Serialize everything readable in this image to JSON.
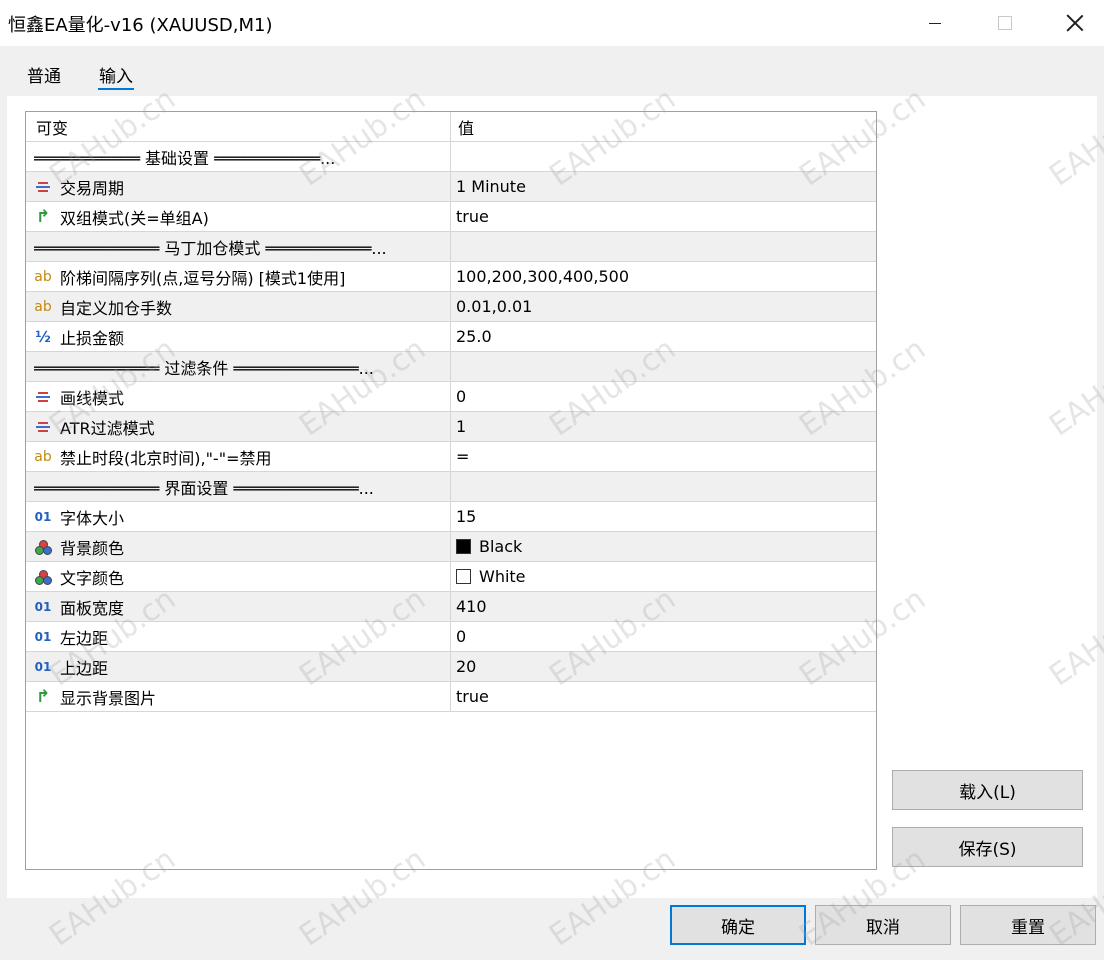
{
  "window": {
    "title": "恒鑫EA量化-v16 (XAUUSD,M1)"
  },
  "tabs": [
    {
      "label": "普通"
    },
    {
      "label": "输入"
    }
  ],
  "table": {
    "header": {
      "name": "可变",
      "value": "值"
    },
    "rows": [
      {
        "icon": "none",
        "name": "═══════════ 基础设置 ═══════════...",
        "value": ""
      },
      {
        "icon": "enum-icon",
        "name": "交易周期",
        "value": "1 Minute"
      },
      {
        "icon": "bool-icon",
        "name": "双组模式(关=单组A)",
        "value": "true"
      },
      {
        "icon": "none",
        "name": "═════════════ 马丁加仓模式 ═══════════...",
        "value": ""
      },
      {
        "icon": "string-icon",
        "name": "阶梯间隔序列(点,逗号分隔) [模式1使用]",
        "value": "100,200,300,400,500"
      },
      {
        "icon": "string-icon",
        "name": "自定义加仓手数",
        "value": "0.01,0.01"
      },
      {
        "icon": "double-icon",
        "name": "止损金额",
        "value": "25.0"
      },
      {
        "icon": "none",
        "name": "═════════════ 过滤条件 ═════════════...",
        "value": ""
      },
      {
        "icon": "enum-icon",
        "name": "画线模式",
        "value": "0"
      },
      {
        "icon": "enum-icon",
        "name": "ATR过滤模式",
        "value": "1"
      },
      {
        "icon": "string-icon",
        "name": "禁止时段(北京时间),\"-\"=禁用",
        "value": "="
      },
      {
        "icon": "none",
        "name": "═════════════ 界面设置 ═════════════...",
        "value": ""
      },
      {
        "icon": "int-icon",
        "name": "字体大小",
        "value": "15"
      },
      {
        "icon": "color-icon",
        "name": "背景颜色",
        "value": "Black",
        "swatch": "#000000"
      },
      {
        "icon": "color-icon",
        "name": "文字颜色",
        "value": "White",
        "swatch": "#ffffff"
      },
      {
        "icon": "int-icon",
        "name": "面板宽度",
        "value": "410"
      },
      {
        "icon": "int-icon",
        "name": "左边距",
        "value": "0"
      },
      {
        "icon": "int-icon",
        "name": "上边距",
        "value": "20"
      },
      {
        "icon": "bool-icon",
        "name": "显示背景图片",
        "value": "true"
      }
    ]
  },
  "buttons": {
    "load": "载入(L)",
    "save": "保存(S)",
    "ok": "确定",
    "cancel": "取消",
    "reset": "重置"
  },
  "icons": {
    "bool_glyph": "↱",
    "string_glyph": "ab",
    "double_glyph": "½",
    "int_glyph": "01"
  },
  "watermark": "EAHub.cn",
  "colors": {
    "accent": "#0078d7",
    "row_alt": "#f0f0f0"
  }
}
